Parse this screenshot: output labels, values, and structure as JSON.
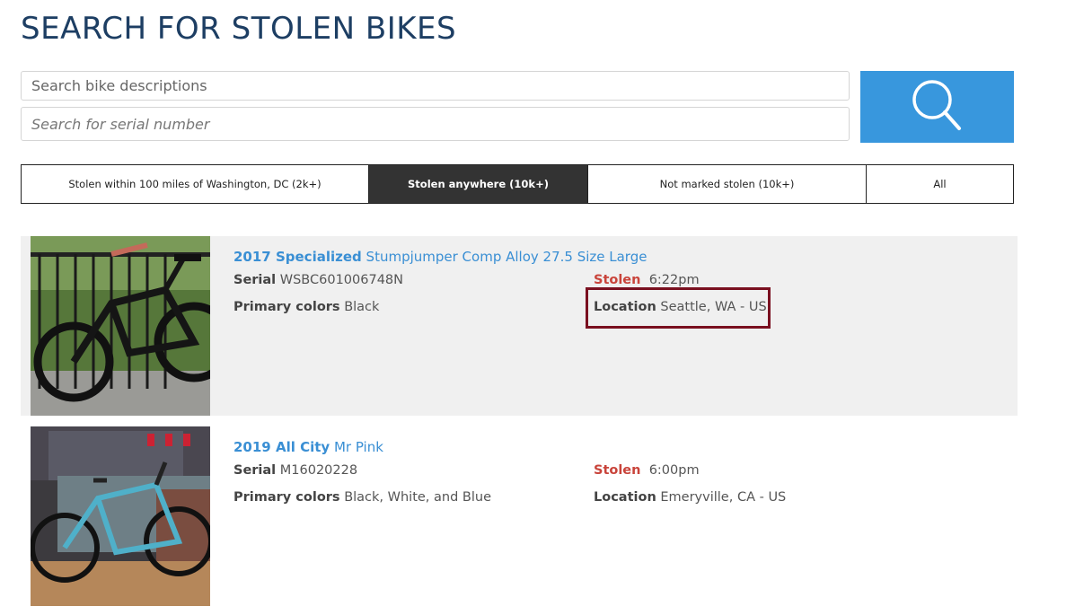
{
  "page": {
    "title": "SEARCH FOR STOLEN BIKES"
  },
  "search": {
    "description_placeholder": "Search bike descriptions",
    "serial_placeholder": "Search for serial number",
    "button_icon": "search-icon"
  },
  "tabs": [
    {
      "label": "Stolen within 100 miles of Washington, DC (2k+)",
      "active": false
    },
    {
      "label": "Stolen anywhere (10k+)",
      "active": true
    },
    {
      "label": "Not marked stolen (10k+)",
      "active": false
    },
    {
      "label": "All",
      "active": false
    }
  ],
  "labels": {
    "serial": "Serial",
    "primary_colors": "Primary colors",
    "stolen": "Stolen",
    "location": "Location"
  },
  "results": [
    {
      "year_make": "2017 Specialized",
      "model": "Stumpjumper Comp Alloy 27.5 Size Large",
      "serial": "WSBC601006748N",
      "primary_colors": "Black",
      "stolen_time": "6:22pm",
      "location": "Seattle, WA - US"
    },
    {
      "year_make": "2019 All City",
      "model": "Mr Pink",
      "serial": "M16020228",
      "primary_colors": "Black, White, and Blue",
      "stolen_time": "6:00pm",
      "location": "Emeryville, CA - US"
    }
  ],
  "colors": {
    "title": "#1d3e63",
    "search_button": "#3897dd",
    "link": "#3a8fd4",
    "stolen": "#c9443b",
    "highlight_box": "#7a1020",
    "active_tab": "#333333"
  }
}
